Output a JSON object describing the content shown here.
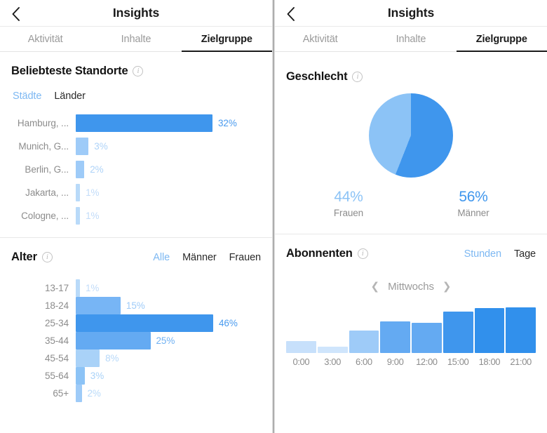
{
  "accent": {
    "dark_blue": "#3f96ed",
    "mid_blue": "#64aaf2",
    "light_blue": "#9ecbf8",
    "pale_blue": "#b9daf9",
    "very_pale_blue": "#c7e0fb",
    "link_blue": "#7db8f2",
    "value_dark": "#4a9bef",
    "value_light": "#aed3f8"
  },
  "left": {
    "nav": {
      "back_icon": "chevron-left-icon",
      "title": "Insights"
    },
    "tabs": [
      {
        "label": "Aktivität",
        "active": false
      },
      {
        "label": "Inhalte",
        "active": false
      },
      {
        "label": "Zielgruppe",
        "active": true
      }
    ],
    "locations": {
      "title": "Beliebteste Standorte",
      "info_icon": "info-icon",
      "toggles": [
        {
          "label": "Städte",
          "selected": true
        },
        {
          "label": "Länder",
          "selected": false
        }
      ],
      "chart_ref": 0
    },
    "age": {
      "title": "Alter",
      "info_icon": "info-icon",
      "toggles": [
        {
          "label": "Alle",
          "selected": true
        },
        {
          "label": "Männer",
          "selected": false
        },
        {
          "label": "Frauen",
          "selected": false
        }
      ],
      "chart_ref": 1
    }
  },
  "right": {
    "nav": {
      "back_icon": "chevron-left-icon",
      "title": "Insights"
    },
    "tabs": [
      {
        "label": "Aktivität",
        "active": false
      },
      {
        "label": "Inhalte",
        "active": false
      },
      {
        "label": "Zielgruppe",
        "active": true
      }
    ],
    "gender": {
      "title": "Geschlecht",
      "info_icon": "info-icon",
      "chart_ref": 2
    },
    "followers": {
      "title": "Abonnenten",
      "info_icon": "info-icon",
      "toggles": [
        {
          "label": "Stunden",
          "selected": true
        },
        {
          "label": "Tage",
          "selected": false
        }
      ],
      "day_nav": {
        "prev_icon": "chevron-left-icon",
        "label": "Mittwochs",
        "next_icon": "chevron-right-icon"
      },
      "chart_ref": 3
    }
  },
  "chart_data": [
    {
      "type": "bar",
      "orientation": "horizontal",
      "title": "Beliebteste Standorte",
      "xlabel": "",
      "ylabel": "",
      "xlim": [
        0,
        32
      ],
      "grid": false,
      "legend": "none",
      "categories": [
        "Hamburg, ...",
        "Munich, G...",
        "Berlin, G...",
        "Jakarta, ...",
        "Cologne, ..."
      ],
      "values": [
        32,
        3,
        2,
        1,
        1
      ],
      "value_labels": [
        "32%",
        "3%",
        "2%",
        "1%",
        "1%"
      ],
      "bar_colors": [
        "#3f96ed",
        "#9ecbf8",
        "#9ecbf8",
        "#b9daf9",
        "#b9daf9"
      ],
      "label_colors": [
        "#4a9bef",
        "#aed3f8",
        "#aed3f8",
        "#c2dcf9",
        "#c2dcf9"
      ]
    },
    {
      "type": "bar",
      "orientation": "horizontal",
      "title": "Alter",
      "xlabel": "",
      "ylabel": "",
      "xlim": [
        0,
        46
      ],
      "grid": false,
      "legend": "none",
      "categories": [
        "13-17",
        "18-24",
        "25-34",
        "35-44",
        "45-54",
        "55-64",
        "65+"
      ],
      "values": [
        1,
        15,
        46,
        25,
        8,
        3,
        2
      ],
      "value_labels": [
        "1%",
        "15%",
        "46%",
        "25%",
        "8%",
        "3%",
        "2%"
      ],
      "bar_colors": [
        "#b9daf9",
        "#77b5f5",
        "#3f96ed",
        "#64aaf2",
        "#a9d2f8",
        "#8cc3f6",
        "#9ecbf8"
      ],
      "label_colors": [
        "#c2dcf9",
        "#9ecbf8",
        "#4a9bef",
        "#6fb1f3",
        "#b6d8f9",
        "#a9d2f8",
        "#b9daf9"
      ]
    },
    {
      "type": "pie",
      "title": "Geschlecht",
      "legend": "bottom",
      "labels": [
        "Frauen",
        "Männer"
      ],
      "values": [
        44,
        56
      ],
      "value_labels": [
        "44%",
        "56%"
      ],
      "slice_colors": [
        "#8cc3f6",
        "#3f96ed"
      ],
      "label_colors": [
        "#8cc3f6",
        "#3f96ed"
      ]
    },
    {
      "type": "bar",
      "orientation": "vertical",
      "title": "Abonnenten",
      "xlabel": "",
      "ylabel": "",
      "grid": false,
      "legend": "none",
      "categories": [
        "0:00",
        "3:00",
        "6:00",
        "9:00",
        "12:00",
        "15:00",
        "18:00",
        "21:00"
      ],
      "values": [
        24,
        13,
        44,
        62,
        60,
        82,
        89,
        90
      ],
      "ylim": [
        0,
        100
      ],
      "bar_colors": [
        "#c7e0fb",
        "#cfe5fc",
        "#9ecbf8",
        "#64aaf2",
        "#64aaf2",
        "#3f96ed",
        "#3190ec",
        "#3190ec"
      ]
    }
  ]
}
